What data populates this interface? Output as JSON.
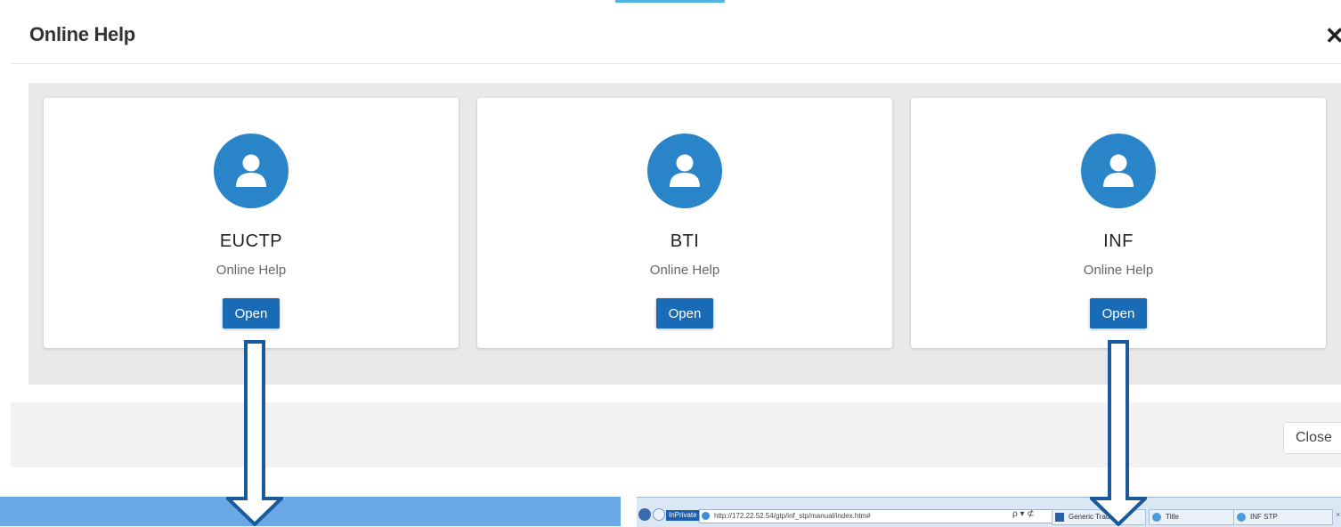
{
  "dialog": {
    "title": "Online Help",
    "close_icon": "✕",
    "close_label": "Close"
  },
  "cards": [
    {
      "name": "EUCTP",
      "subtitle": "Online Help",
      "button": "Open",
      "icon": "user-avatar-icon"
    },
    {
      "name": "BTI",
      "subtitle": "Online Help",
      "button": "Open",
      "icon": "user-avatar-icon"
    },
    {
      "name": "INF",
      "subtitle": "Online Help",
      "button": "Open",
      "icon": "user-avatar-icon"
    }
  ],
  "browser_strip": {
    "inprivate_label": "InPrivate",
    "url": "http://172.22.52.54/gtp/inf_stp/manual/index.htm#",
    "search_controls": "ρ ▾ ⊄",
    "tabs": [
      "Generic Trader",
      "Title",
      "INF STP"
    ],
    "tab_close": "×"
  },
  "colors": {
    "accent": "#2a85c8",
    "button": "#1a6bb5",
    "arrow": "#1a5a9a"
  }
}
